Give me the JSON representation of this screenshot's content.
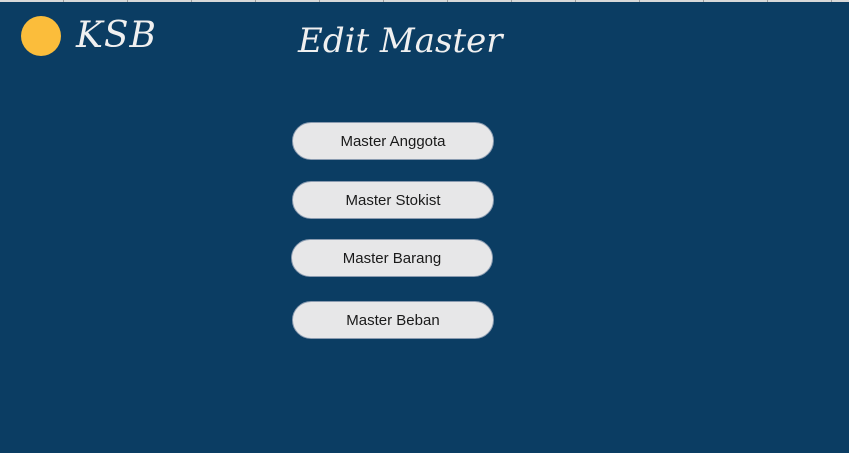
{
  "header": {
    "brand": "KSB",
    "title": "Edit Master"
  },
  "menu": {
    "items": [
      {
        "label": "Master Anggota"
      },
      {
        "label": "Master Stokist"
      },
      {
        "label": "Master Barang"
      },
      {
        "label": "Master Beban"
      }
    ]
  },
  "colors": {
    "background": "#0b3d63",
    "logo": "#fbbd3b",
    "button": "#e7e7e8",
    "title_text": "#f0f0f0"
  }
}
